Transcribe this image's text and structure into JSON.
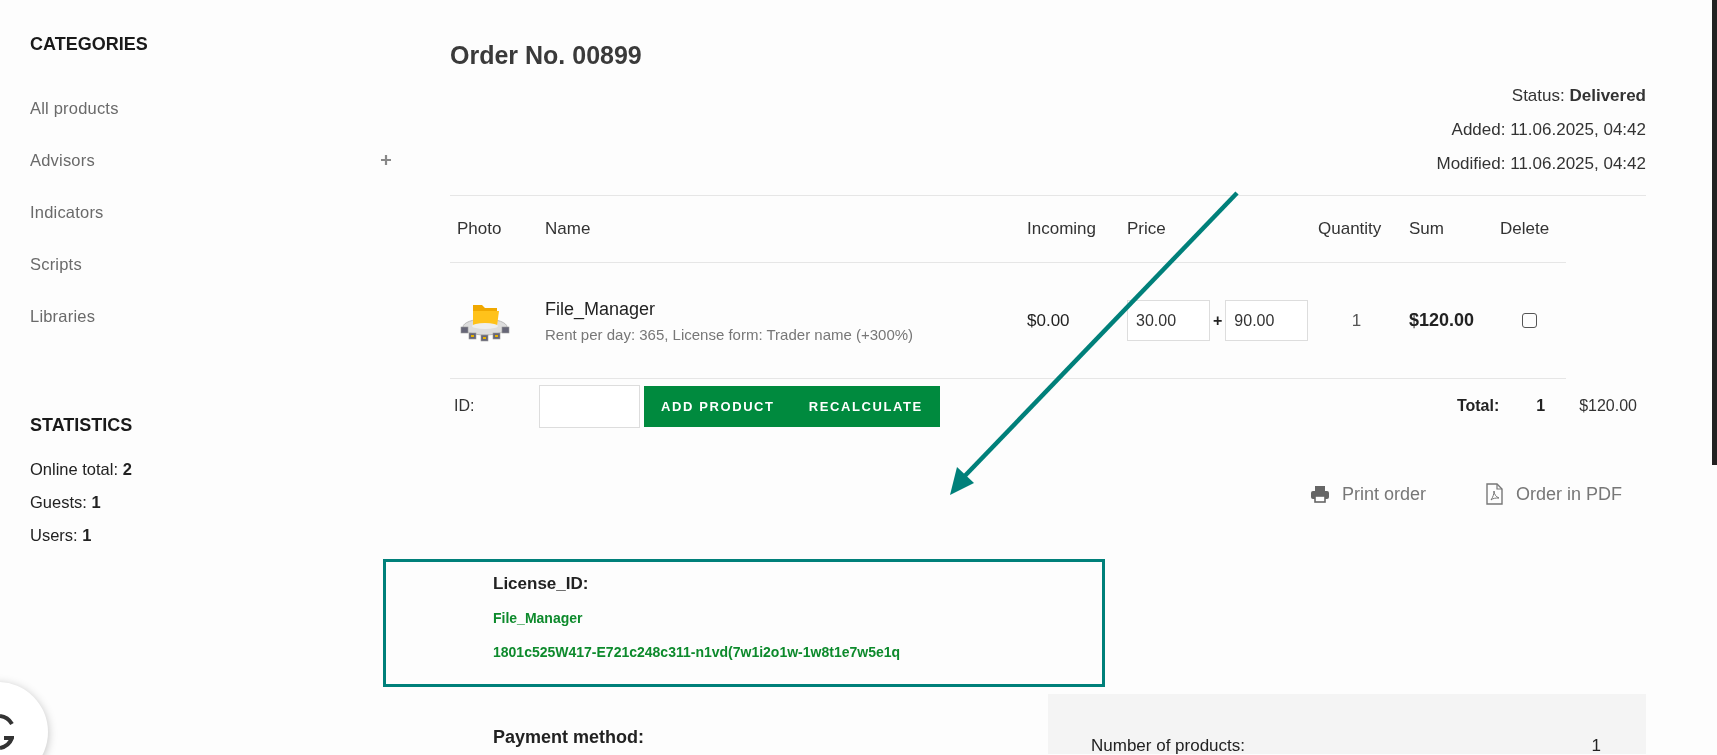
{
  "sidebar": {
    "categories_title": "CATEGORIES",
    "categories": [
      {
        "label": "All products",
        "expandable": false
      },
      {
        "label": "Advisors",
        "expandable": true
      },
      {
        "label": "Indicators",
        "expandable": false
      },
      {
        "label": "Scripts",
        "expandable": false
      },
      {
        "label": "Libraries",
        "expandable": false
      }
    ],
    "statistics_title": "STATISTICS",
    "statistics": [
      "Online total: **2**",
      "Guests: **1**",
      "Users: **1**"
    ]
  },
  "order": {
    "title": "Order No. 00899",
    "meta": [
      "Status: **Delivered**",
      "Added: 11.06.2025, 04:42",
      "Modified: 11.06.2025, 04:42"
    ]
  },
  "table": {
    "columns": [
      "Photo",
      "Name",
      "Incoming",
      "Price",
      "Quantity",
      "Sum",
      "Delete"
    ],
    "rows": [
      {
        "name": "File_Manager",
        "options": "Rent per day: 365, License form: Trader name (+300%)",
        "incoming": "$0.00",
        "price": "30.00",
        "price_separator": "+",
        "price_extra": "90.00",
        "quantity": "1",
        "sum": "$120.00",
        "checked": false
      }
    ]
  },
  "add_row": {
    "id_label": "ID:",
    "buttons": [
      "ADD PRODUCT",
      "RECALCULATE"
    ],
    "total_label": "Total:",
    "total_quantity": "1",
    "total_sum": "$120.00"
  },
  "actions": [
    {
      "kind": "print",
      "label": "Print order"
    },
    {
      "kind": "pdf",
      "label": "Order in PDF"
    }
  ],
  "license": {
    "title": "License_ID:",
    "product": "File_Manager",
    "key": "1801c525W417-E721c248c311-n1vd(7w1i2o1w-1w8t1e7w5e1q",
    "highlighted": true
  },
  "payment": {
    "title": "Payment method:"
  },
  "summary": [
    {
      "label": "Number of products:",
      "value": "1"
    }
  ]
}
